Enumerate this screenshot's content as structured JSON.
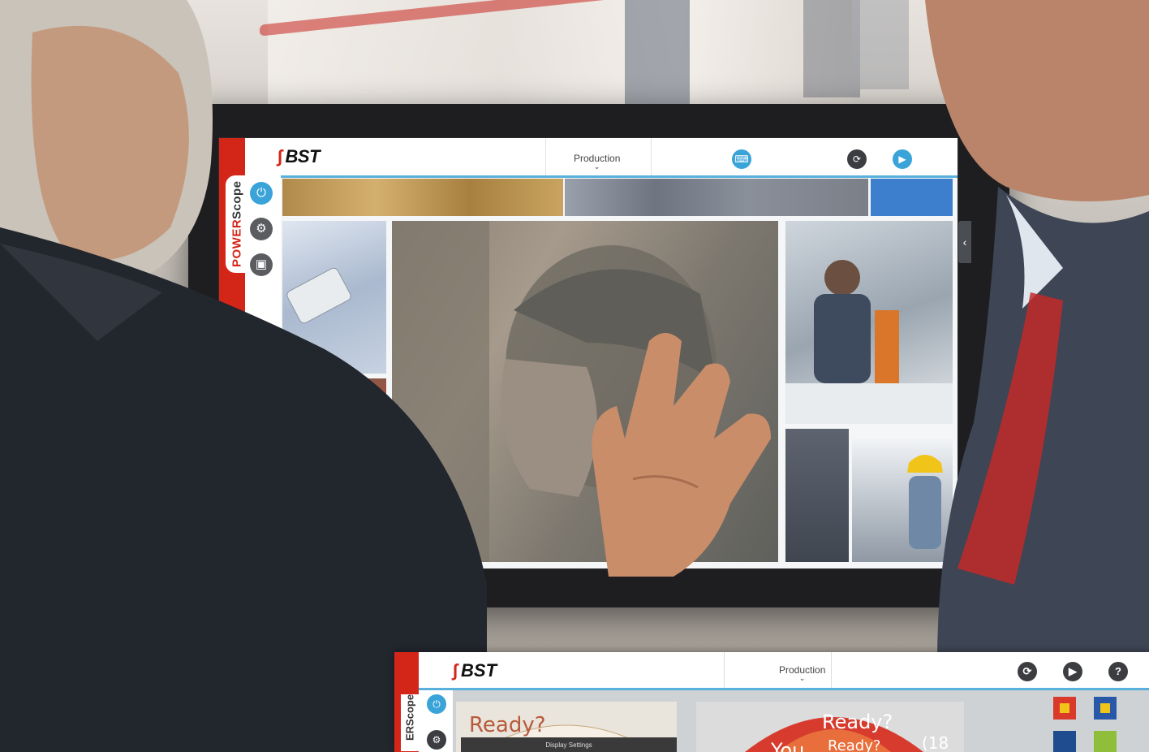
{
  "screen_ui": {
    "brand": "BST",
    "side_label_primary": "POWER",
    "side_label_secondary": "Scope",
    "nav_label": "Production",
    "nav_chevron": "⌄",
    "side_icons": [
      {
        "name": "power-icon",
        "glyph": "⏻"
      },
      {
        "name": "gear-icon",
        "glyph": "⚙"
      },
      {
        "name": "display-icon",
        "glyph": "▣"
      }
    ],
    "toolbar_icons": [
      {
        "name": "keyboard-icon",
        "glyph": "⌨",
        "color": "#3aa3d8"
      },
      {
        "name": "repeat-icon",
        "glyph": "⟳",
        "color": "#3c3d40"
      },
      {
        "name": "play-icon",
        "glyph": "▶",
        "color": "#3aa3d8"
      }
    ],
    "collapse_glyph": "‹"
  },
  "inset_ui": {
    "brand": "BST",
    "side_label": "ERScope",
    "nav_label": "Production",
    "nav_chevron": "⌄",
    "toolbar_icons": [
      {
        "name": "repeat-icon",
        "glyph": "⟳"
      },
      {
        "name": "play-icon",
        "glyph": "▶"
      },
      {
        "name": "help-icon",
        "glyph": "?"
      }
    ],
    "side_icons": [
      {
        "name": "power-icon",
        "glyph": "⏻"
      },
      {
        "name": "gear-icon",
        "glyph": "⚙"
      }
    ],
    "ready_text_left": "Ready?",
    "ready_text_right": "Ready?",
    "you_text": "You",
    "count_text": "(18",
    "ready_partial": "Ready?",
    "display_settings": "Display Settings"
  },
  "colors": {
    "brand_red": "#d42519",
    "accent_blue": "#3aa3d8",
    "icon_dark": "#3c3d40"
  }
}
